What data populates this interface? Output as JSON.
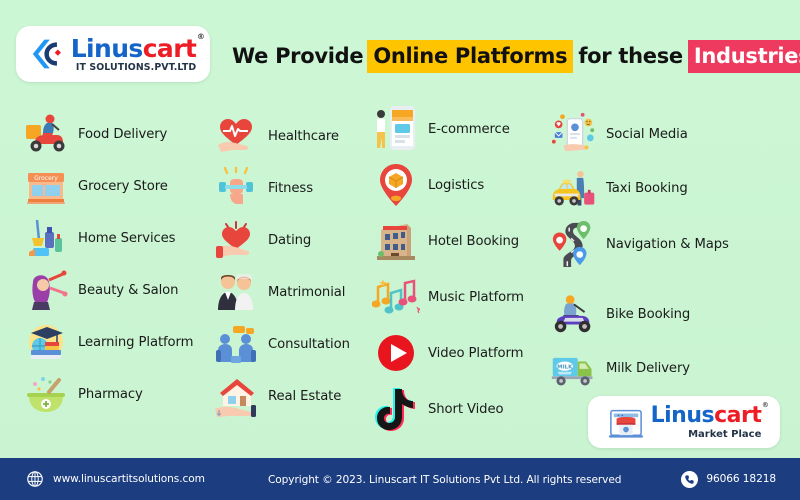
{
  "brand": {
    "logo_name_part1": "Linus",
    "logo_name_part2": "cart",
    "logo_registered": "®",
    "logo_tagline": "IT SOLUTIONS.PVT.LTD",
    "colors": {
      "blue": "#1565C8",
      "red": "#EE1C25",
      "highlight_yellow": "#FFC400",
      "highlight_pink": "#EE3A5E",
      "footer_navy": "#1C3D80",
      "background_mint": "#CCF5D3"
    }
  },
  "header": {
    "headline_part1": "We Provide",
    "headline_highlight1": "Online Platforms",
    "headline_part2": "for these",
    "headline_highlight2": "Industries"
  },
  "columns": [
    {
      "items": [
        {
          "label": "Food Delivery",
          "icon": "scooter-delivery-icon"
        },
        {
          "label": "Grocery Store",
          "icon": "grocery-storefront-icon"
        },
        {
          "label": "Home Services",
          "icon": "cleaning-supplies-icon"
        },
        {
          "label": "Beauty & Salon",
          "icon": "salon-haircut-icon"
        },
        {
          "label": "Learning Platform",
          "icon": "graduation-books-icon"
        },
        {
          "label": "Pharmacy",
          "icon": "mortar-pestle-icon"
        }
      ]
    },
    {
      "items": [
        {
          "label": "Healthcare",
          "icon": "heart-pulse-hand-icon"
        },
        {
          "label": "Fitness",
          "icon": "dumbbell-arm-icon"
        },
        {
          "label": "Dating",
          "icon": "heart-hand-icon"
        },
        {
          "label": "Matrimonial",
          "icon": "wedding-couple-icon"
        },
        {
          "label": "Consultation",
          "icon": "two-people-chat-icon"
        },
        {
          "label": "Real Estate",
          "icon": "house-key-hand-icon"
        }
      ]
    },
    {
      "items": [
        {
          "label": "E-commerce",
          "icon": "mobile-shop-icon"
        },
        {
          "label": "Logistics",
          "icon": "location-pin-box-icon"
        },
        {
          "label": "Hotel Booking",
          "icon": "hotel-building-icon"
        },
        {
          "label": "Music Platform",
          "icon": "music-notes-icon"
        },
        {
          "label": "Video Platform",
          "icon": "play-button-icon"
        },
        {
          "label": "Short Video",
          "icon": "tiktok-note-icon"
        }
      ]
    },
    {
      "items": [
        {
          "label": "Social Media",
          "icon": "phone-social-reactions-icon"
        },
        {
          "label": "Taxi Booking",
          "icon": "taxi-cab-icon"
        },
        {
          "label": "Navigation & Maps",
          "icon": "road-map-pins-icon"
        },
        {
          "label": "Bike Booking",
          "icon": "motorbike-rider-icon"
        },
        {
          "label": "Milk Delivery",
          "icon": "milk-truck-icon"
        }
      ]
    }
  ],
  "marketplace_card": {
    "name_part1": "Linus",
    "name_part2": "cart",
    "registered": "®",
    "subtitle": "Market Place",
    "icon": "storefront-icon"
  },
  "footer": {
    "website": "www.linuscartitsolutions.com",
    "copyright": "Copyright © 2023.  Linuscart IT Solutions Pvt Ltd.  All rights reserved",
    "phone": "96066 18218",
    "globe_icon": "globe-icon",
    "phone_icon": "phone-icon"
  }
}
